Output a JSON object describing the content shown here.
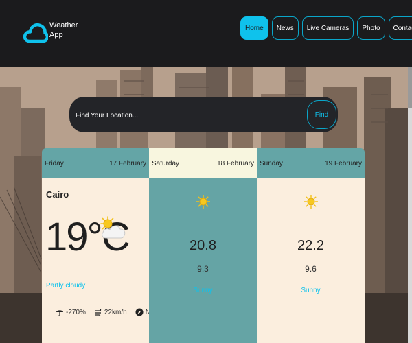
{
  "brand": {
    "line1": "Weather",
    "line2": "App",
    "logo_icon": "cloud-icon",
    "logo_color": "#0fc2ec"
  },
  "nav": {
    "items": [
      {
        "label": "Home",
        "active": true
      },
      {
        "label": "News",
        "active": false
      },
      {
        "label": "Live Cameras",
        "active": false
      },
      {
        "label": "Photo",
        "active": false
      },
      {
        "label": "Contact",
        "active": false
      }
    ]
  },
  "search": {
    "placeholder": "Find Your Location...",
    "button_label": "Find"
  },
  "colors": {
    "accent": "#0fc2ec",
    "header_bg": "#1b1b1d",
    "teal": "#64a5a6",
    "cream": "#fbeede"
  },
  "forecast": [
    {
      "day": "Friday",
      "date": "17 February",
      "city": "Cairo",
      "temp": "19°C",
      "condition": "Partly cloudy",
      "icon": "partly-cloudy-icon",
      "humidity": "-270%",
      "wind": "22km/h",
      "direction": "NNE"
    },
    {
      "day": "Saturday",
      "date": "18 February",
      "max": "20.8",
      "min": "9.3",
      "condition": "Sunny",
      "icon": "sun-icon"
    },
    {
      "day": "Sunday",
      "date": "19 February",
      "max": "22.2",
      "min": "9.6",
      "condition": "Sunny",
      "icon": "sun-icon"
    }
  ]
}
